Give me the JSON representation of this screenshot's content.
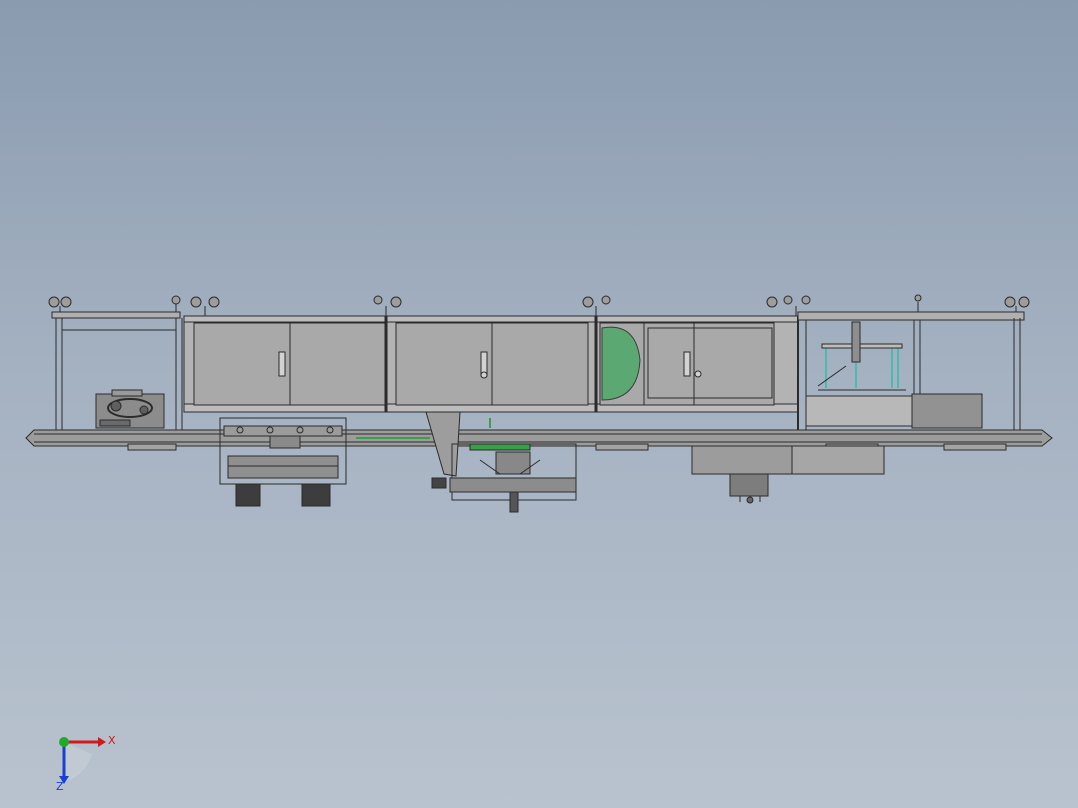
{
  "viewport": {
    "background_top": "#8a9bb0",
    "background_bottom": "#b9c3cf"
  },
  "model": {
    "line_color": "#2b2b2b",
    "panel_color": "#a9a9a9",
    "highlight_green": "#4fa86a",
    "highlight_teal": "#4fb8b0"
  },
  "triad": {
    "x_label": "X",
    "z_label": "Z",
    "x_color": "#d11a1a",
    "y_color": "#1faa2b",
    "z_color": "#1a3fd1"
  }
}
